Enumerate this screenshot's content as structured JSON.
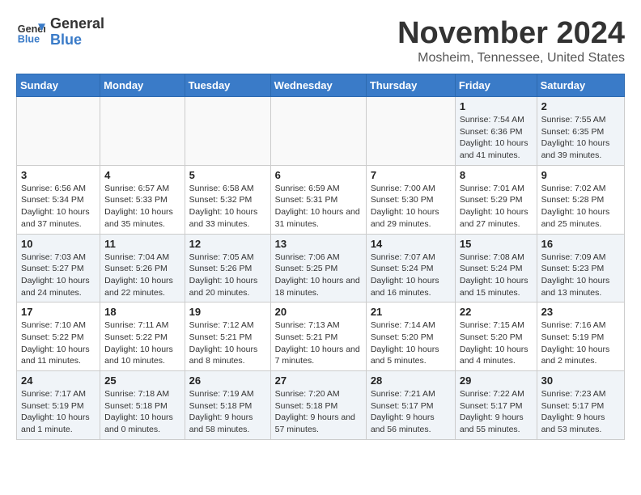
{
  "logo": {
    "line1": "General",
    "line2": "Blue"
  },
  "title": "November 2024",
  "location": "Mosheim, Tennessee, United States",
  "weekdays": [
    "Sunday",
    "Monday",
    "Tuesday",
    "Wednesday",
    "Thursday",
    "Friday",
    "Saturday"
  ],
  "weeks": [
    [
      {
        "day": "",
        "info": ""
      },
      {
        "day": "",
        "info": ""
      },
      {
        "day": "",
        "info": ""
      },
      {
        "day": "",
        "info": ""
      },
      {
        "day": "",
        "info": ""
      },
      {
        "day": "1",
        "info": "Sunrise: 7:54 AM\nSunset: 6:36 PM\nDaylight: 10 hours and 41 minutes."
      },
      {
        "day": "2",
        "info": "Sunrise: 7:55 AM\nSunset: 6:35 PM\nDaylight: 10 hours and 39 minutes."
      }
    ],
    [
      {
        "day": "3",
        "info": "Sunrise: 6:56 AM\nSunset: 5:34 PM\nDaylight: 10 hours and 37 minutes."
      },
      {
        "day": "4",
        "info": "Sunrise: 6:57 AM\nSunset: 5:33 PM\nDaylight: 10 hours and 35 minutes."
      },
      {
        "day": "5",
        "info": "Sunrise: 6:58 AM\nSunset: 5:32 PM\nDaylight: 10 hours and 33 minutes."
      },
      {
        "day": "6",
        "info": "Sunrise: 6:59 AM\nSunset: 5:31 PM\nDaylight: 10 hours and 31 minutes."
      },
      {
        "day": "7",
        "info": "Sunrise: 7:00 AM\nSunset: 5:30 PM\nDaylight: 10 hours and 29 minutes."
      },
      {
        "day": "8",
        "info": "Sunrise: 7:01 AM\nSunset: 5:29 PM\nDaylight: 10 hours and 27 minutes."
      },
      {
        "day": "9",
        "info": "Sunrise: 7:02 AM\nSunset: 5:28 PM\nDaylight: 10 hours and 25 minutes."
      }
    ],
    [
      {
        "day": "10",
        "info": "Sunrise: 7:03 AM\nSunset: 5:27 PM\nDaylight: 10 hours and 24 minutes."
      },
      {
        "day": "11",
        "info": "Sunrise: 7:04 AM\nSunset: 5:26 PM\nDaylight: 10 hours and 22 minutes."
      },
      {
        "day": "12",
        "info": "Sunrise: 7:05 AM\nSunset: 5:26 PM\nDaylight: 10 hours and 20 minutes."
      },
      {
        "day": "13",
        "info": "Sunrise: 7:06 AM\nSunset: 5:25 PM\nDaylight: 10 hours and 18 minutes."
      },
      {
        "day": "14",
        "info": "Sunrise: 7:07 AM\nSunset: 5:24 PM\nDaylight: 10 hours and 16 minutes."
      },
      {
        "day": "15",
        "info": "Sunrise: 7:08 AM\nSunset: 5:24 PM\nDaylight: 10 hours and 15 minutes."
      },
      {
        "day": "16",
        "info": "Sunrise: 7:09 AM\nSunset: 5:23 PM\nDaylight: 10 hours and 13 minutes."
      }
    ],
    [
      {
        "day": "17",
        "info": "Sunrise: 7:10 AM\nSunset: 5:22 PM\nDaylight: 10 hours and 11 minutes."
      },
      {
        "day": "18",
        "info": "Sunrise: 7:11 AM\nSunset: 5:22 PM\nDaylight: 10 hours and 10 minutes."
      },
      {
        "day": "19",
        "info": "Sunrise: 7:12 AM\nSunset: 5:21 PM\nDaylight: 10 hours and 8 minutes."
      },
      {
        "day": "20",
        "info": "Sunrise: 7:13 AM\nSunset: 5:21 PM\nDaylight: 10 hours and 7 minutes."
      },
      {
        "day": "21",
        "info": "Sunrise: 7:14 AM\nSunset: 5:20 PM\nDaylight: 10 hours and 5 minutes."
      },
      {
        "day": "22",
        "info": "Sunrise: 7:15 AM\nSunset: 5:20 PM\nDaylight: 10 hours and 4 minutes."
      },
      {
        "day": "23",
        "info": "Sunrise: 7:16 AM\nSunset: 5:19 PM\nDaylight: 10 hours and 2 minutes."
      }
    ],
    [
      {
        "day": "24",
        "info": "Sunrise: 7:17 AM\nSunset: 5:19 PM\nDaylight: 10 hours and 1 minute."
      },
      {
        "day": "25",
        "info": "Sunrise: 7:18 AM\nSunset: 5:18 PM\nDaylight: 10 hours and 0 minutes."
      },
      {
        "day": "26",
        "info": "Sunrise: 7:19 AM\nSunset: 5:18 PM\nDaylight: 9 hours and 58 minutes."
      },
      {
        "day": "27",
        "info": "Sunrise: 7:20 AM\nSunset: 5:18 PM\nDaylight: 9 hours and 57 minutes."
      },
      {
        "day": "28",
        "info": "Sunrise: 7:21 AM\nSunset: 5:17 PM\nDaylight: 9 hours and 56 minutes."
      },
      {
        "day": "29",
        "info": "Sunrise: 7:22 AM\nSunset: 5:17 PM\nDaylight: 9 hours and 55 minutes."
      },
      {
        "day": "30",
        "info": "Sunrise: 7:23 AM\nSunset: 5:17 PM\nDaylight: 9 hours and 53 minutes."
      }
    ]
  ]
}
